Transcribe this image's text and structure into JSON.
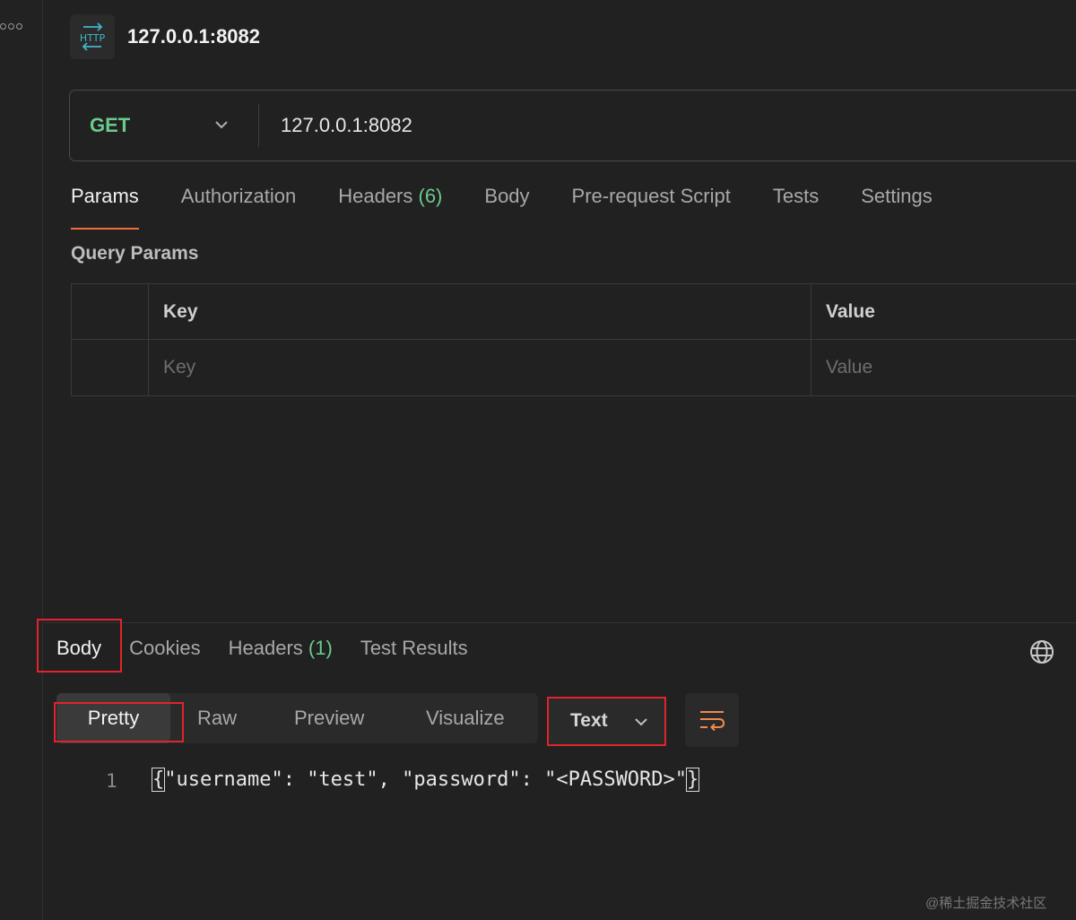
{
  "header": {
    "badge_text": "HTTP",
    "title": "127.0.0.1:8082"
  },
  "request": {
    "method": "GET",
    "url": "127.0.0.1:8082"
  },
  "request_tabs": {
    "params": "Params",
    "authorization": "Authorization",
    "headers": "Headers",
    "headers_count": "(6)",
    "body": "Body",
    "pre_request": "Pre-request Script",
    "tests": "Tests",
    "settings": "Settings"
  },
  "query_params": {
    "title": "Query Params",
    "key_header": "Key",
    "value_header": "Value",
    "key_placeholder": "Key",
    "value_placeholder": "Value"
  },
  "response_tabs": {
    "body": "Body",
    "cookies": "Cookies",
    "headers": "Headers",
    "headers_count": "(1)",
    "test_results": "Test Results"
  },
  "format": {
    "pretty": "Pretty",
    "raw": "Raw",
    "preview": "Preview",
    "visualize": "Visualize",
    "language": "Text"
  },
  "response_body": {
    "line_number": "1",
    "open_brace": "{",
    "content": "\"username\": \"test\", \"password\": \"<PASSWORD>\"",
    "close_brace": "}"
  },
  "watermark": "@稀土掘金技术社区",
  "colors": {
    "background": "#212121",
    "method_green": "#6bcb8b",
    "active_tab_underline": "#f26b3a",
    "highlight_box": "#e0232e",
    "wrap_icon": "#f08a4b",
    "http_icon": "#3fb6c9"
  },
  "icons": {
    "more": "more-options-icon",
    "http": "http-icon",
    "method_dropdown": "chevron-down-icon",
    "globe": "globe-icon",
    "language_dropdown": "chevron-down-icon",
    "wrap": "word-wrap-icon"
  }
}
